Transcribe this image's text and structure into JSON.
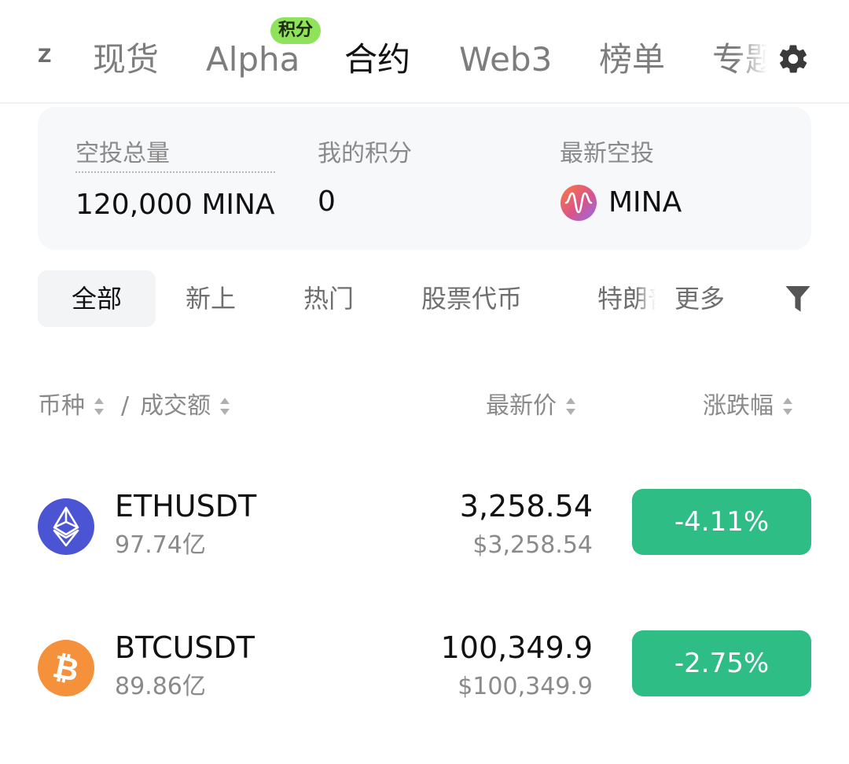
{
  "top_tabs": {
    "cut_left": "Ζ",
    "items": [
      {
        "label": "现货"
      },
      {
        "label": "Alpha",
        "badge": "积分"
      },
      {
        "label": "合约"
      },
      {
        "label": "Web3"
      },
      {
        "label": "榜单"
      },
      {
        "label": "专题"
      }
    ],
    "active_index": 2
  },
  "airdrop_card": {
    "total_label": "空投总量",
    "total_value": "120,000 MINA",
    "points_label": "我的积分",
    "points_value": "0",
    "latest_label": "最新空投",
    "latest_value": "MINA",
    "latest_icon": "mina-token-icon"
  },
  "filters": {
    "items": [
      "全部",
      "新上",
      "热门",
      "股票代币",
      "特朗普",
      "更多"
    ],
    "active_index": 0,
    "filter_icon": "funnel-icon"
  },
  "column_headers": {
    "coin": "币种",
    "separator": "/",
    "volume": "成交额",
    "last_price": "最新价",
    "change": "涨跌幅"
  },
  "rows": [
    {
      "pair": "ETHUSDT",
      "volume": "97.74亿",
      "price": "3,258.54",
      "usd_price": "$3,258.54",
      "change": "-4.11%",
      "icon": "eth-icon",
      "icon_color": "#4b55d4"
    },
    {
      "pair": "BTCUSDT",
      "volume": "89.86亿",
      "price": "100,349.9",
      "usd_price": "$100,349.9",
      "change": "-2.75%",
      "icon": "btc-icon",
      "icon_color": "#f4913a"
    }
  ],
  "colors": {
    "change_badge": "#2ebd85",
    "alpha_badge": "#8fe35b"
  }
}
